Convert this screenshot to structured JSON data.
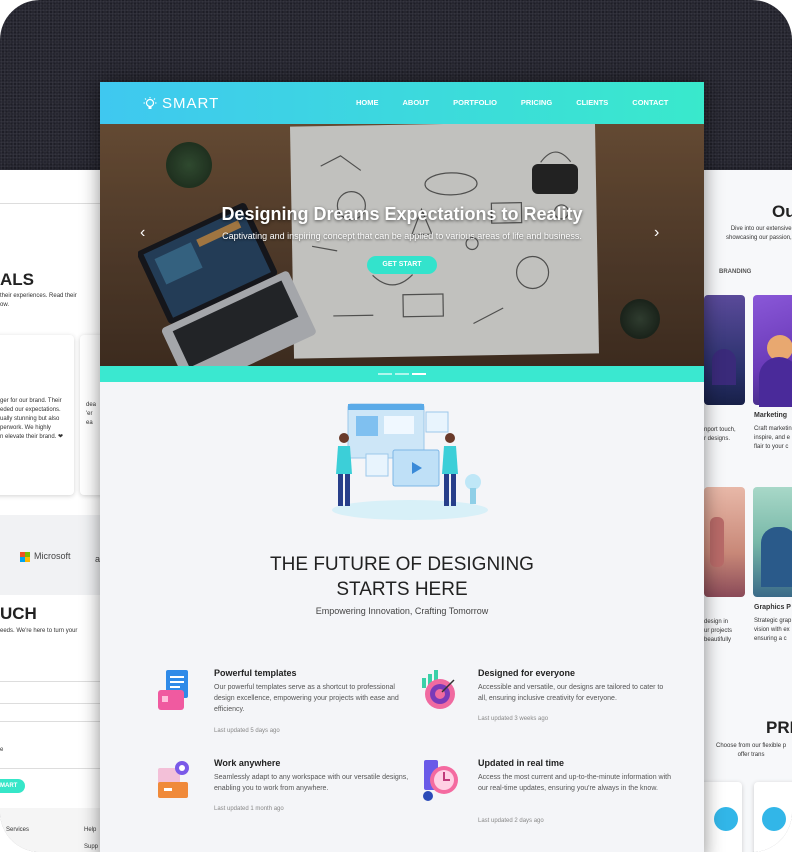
{
  "brand": {
    "name": "SMART"
  },
  "nav": {
    "items": [
      "HOME",
      "ABOUT",
      "PORTFOLIO",
      "PRICING",
      "CLIENTS",
      "CONTACT"
    ]
  },
  "hero": {
    "title": "Designing Dreams Expectations to Reality",
    "subtitle": "Captivating and inspiring concept that can be applied to various areas of life and business.",
    "button": "GET START",
    "prev": "‹",
    "next": "›"
  },
  "section": {
    "title_line1": "THE FUTURE OF DESIGNING",
    "title_line2": "STARTS HERE",
    "tagline": "Empowering Innovation, Crafting Tomorrow"
  },
  "features": [
    {
      "title": "Powerful templates",
      "desc": "Our powerful templates serve as a shortcut to professional design excellence, empowering your projects with ease and efficiency.",
      "updated": "Last updated 5 days ago"
    },
    {
      "title": "Designed for everyone",
      "desc": "Accessible and versatile, our designs are tailored to cater to all, ensuring inclusive creativity for everyone.",
      "updated": "Last updated 3 weeks ago"
    },
    {
      "title": "Work anywhere",
      "desc": "Seamlessly adapt to any workspace with our versatile designs, enabling you to work from anywhere.",
      "updated": "Last updated 1 month ago"
    },
    {
      "title": "Updated in real time",
      "desc": "Access the most current and up-to-the-minute information with our real-time updates, ensuring you're always in the know.",
      "updated": "Last updated 2 days ago"
    }
  ],
  "left_page": {
    "heading1": "ALS",
    "intro": "their experiences. Read their\now.",
    "testimonial": "ger for our brand. Their\neded our expectations.\nually stunning but also\nperwork. We highly\nn elevate their brand. ❤",
    "testimonial2": "dea\n'er\nea",
    "partner": "Microsoft",
    "partner2": "a",
    "heading2": "UCH",
    "contact_intro": "eeds. We're here to turn your",
    "field_label": "e",
    "submit": "MART",
    "footer1": "Services",
    "footer2": "Help",
    "footer3": "Supp"
  },
  "right_page": {
    "heading1": "Ou",
    "intro": "Dive into our extensive p\nshowcasing our passion, inn",
    "filter": "BRANDING",
    "card1_title": "Marketing",
    "card1_desc": "Craft marketin\ninspire, and e\nflair to your c",
    "left_desc1": "nport touch,\nr designs.",
    "card2_title": "Graphics P",
    "card2_desc": "Strategic grap\nvision with ex\nensuring a c",
    "left_desc2": "design in\nur projects\nbeautifully",
    "heading2": "PRI",
    "pricing_intro": "Choose from our flexible p\noffer trans"
  },
  "colors": {
    "accent": "#39e9cc",
    "accent2": "#3fc8f0",
    "background": "#262630"
  }
}
